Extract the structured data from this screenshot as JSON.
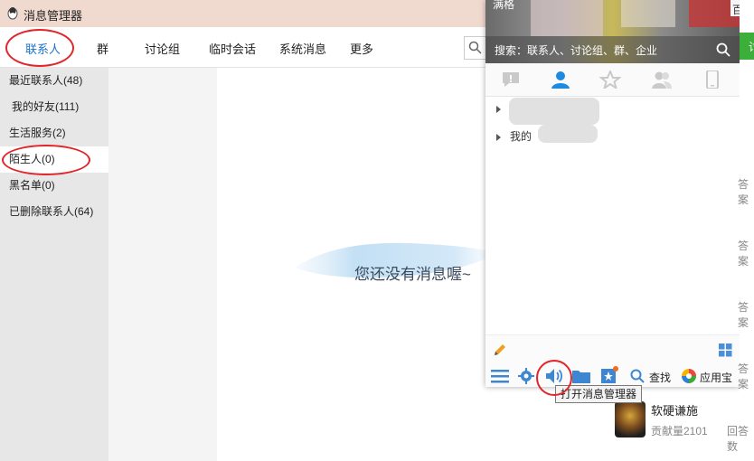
{
  "mm": {
    "title": "消息管理器",
    "tabs": [
      "联系人",
      "群",
      "讨论组",
      "临时会话",
      "系统消息",
      "更多"
    ],
    "sidebar": [
      "最近联系人(48)",
      "我的好友(111)",
      "生活服务(2)",
      "陌生人(0)",
      "黑名单(0)",
      "已删除联系人(64)"
    ],
    "empty_text": "您还没有消息喔~"
  },
  "qq": {
    "header_name": "满格",
    "search_placeholder": "搜索：联系人、讨论组、群、企业",
    "group_2": "我的",
    "find_label": "查找",
    "appstore_label": "应用宝"
  },
  "tooltip": "打开消息管理器",
  "bg": {
    "top_right": "百度",
    "green_btn": "讨",
    "side_labels": [
      "答案",
      "答案",
      "答案",
      "答案"
    ],
    "user_name": "软硬谦施",
    "contrib": "贡献量2101",
    "answered": "回答数"
  },
  "colors": {
    "accent": "#1c74c9",
    "annotation": "#e0262b",
    "titlebar": "#f0d9cf"
  }
}
